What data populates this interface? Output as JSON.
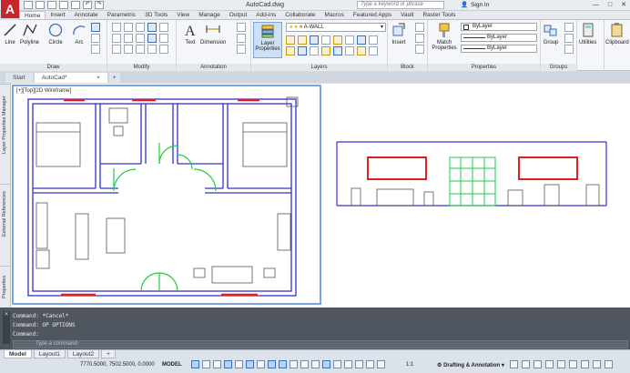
{
  "window": {
    "doc_title": "AutoCad.dwg",
    "search_placeholder": "Type a keyword or phrase",
    "signin": "Sign In",
    "logo": "A",
    "controls": [
      "—",
      "□",
      "✕"
    ]
  },
  "ribbon_tabs": [
    "Home",
    "Insert",
    "Annotate",
    "Parametric",
    "3D Tools",
    "View",
    "Manage",
    "Output",
    "Add-ins",
    "Collaborate",
    "Macros",
    "Featured Apps",
    "Vault",
    "Raster Tools"
  ],
  "ribbon": {
    "draw": {
      "title": "Draw",
      "tools": [
        "Line",
        "Polyline",
        "Circle",
        "Arc"
      ]
    },
    "modify": {
      "title": "Modify"
    },
    "annotation": {
      "title": "Annotation",
      "tools": [
        "Text",
        "Dimension"
      ]
    },
    "layers": {
      "title": "Layers",
      "layer_properties": "Layer\nProperties",
      "current_layer": "A-WALL"
    },
    "block": {
      "title": "Block",
      "insert": "Insert"
    },
    "properties": {
      "title": "Properties",
      "match": "Match\nProperties",
      "bylayer1": "ByLayer",
      "bylayer2": "ByLayer",
      "bylayer3": "ByLayer"
    },
    "groups": {
      "title": "Groups",
      "group": "Group"
    },
    "utilities": "Utilities",
    "clipboard": "Clipboard"
  },
  "doc_tabs": {
    "start": "Start",
    "active": "AutoCad*",
    "close": "×"
  },
  "palettes": [
    "Layer Properties Manager",
    "External References",
    "Properties"
  ],
  "viewport": {
    "label": "[+][Top][2D Wireframe]"
  },
  "command": {
    "history": [
      "Command: *Cancel*",
      "Command: OP OPTIONS",
      "Command:"
    ],
    "placeholder": "Type a command"
  },
  "status": {
    "layout_tabs": [
      "Model",
      "Layout1",
      "Layout2",
      "+"
    ],
    "coords": "7770.5000, 7502.5000, 0.0000",
    "space": "MODEL",
    "scale": "1:1",
    "workspace": "Drafting & Annotation"
  },
  "colors": {
    "wall": "#3333cc",
    "window": "#e02020",
    "door": "#22cc44",
    "furniture": "#555555",
    "accent": "#3a6fb5"
  }
}
